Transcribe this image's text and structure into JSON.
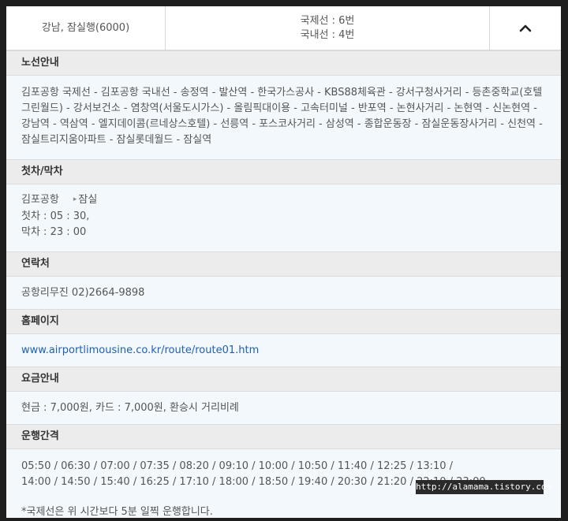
{
  "route_header": {
    "route_name": "강남, 잠실행(6000)",
    "intl_terminal": "국제선 : 6번",
    "domestic_terminal": "국내선 : 4번"
  },
  "sections": {
    "route_info": {
      "title": "노선안내",
      "text": "김포공항 국제선 - 김포공항 국내선 - 송정역 - 발산역 - 한국가스공사 - KBS88체육관 - 강서구청사거리 - 등촌중학교(호텔그린월드) - 강서보건소 - 염창역(서울도시가스) - 올림픽대이용 - 고속터미널 - 반포역 - 논현사거리 - 논현역 - 신논현역 - 강남역 - 역삼역 - 엘지데이콤(르네상스호텔) - 선릉역 - 포스코사거리 - 삼성역 - 종합운동장 - 잠실운동장사거리 - 신천역 - 잠실트리지움아파트 - 잠실롯데월드 - 잠실역"
    },
    "first_last": {
      "title": "첫차/막차",
      "from": "김포공항",
      "to": "잠실",
      "first": "첫차 : 05 : 30,",
      "last": "막차 : 23 : 00"
    },
    "contact": {
      "title": "연락처",
      "text": "공항리무진 02)2664-9898"
    },
    "homepage": {
      "title": "홈페이지",
      "url": "www.airportlimousine.co.kr/route/route01.htm"
    },
    "fare": {
      "title": "요금안내",
      "text": "현금 : 7,000원, 카드 : 7,000원, 환승시 거리비례"
    },
    "interval": {
      "title": "운행간격",
      "line1": "05:50 / 06:30 / 07:00 / 07:35 / 08:20 / 09:10 / 10:00 / 10:50 / 11:40 / 12:25 / 13:10 /",
      "line2": "14:00 / 14:50 / 15:40 / 16:25 / 17:10 / 18:00 / 18:50 / 19:40 / 20:30 / 21:20 / 22:10 / 23:00",
      "note": "*국제선은 위 시간보다 5분 일찍 운행합니다."
    }
  },
  "watermark": "http://alamama.tistory.com",
  "icons": {
    "collapse": "chevron-up-icon",
    "arrow": "arrow-right-icon"
  },
  "colors": {
    "link": "#1f5fb3",
    "header_bg": "#ececec",
    "body_bg": "#f3f8fc"
  }
}
